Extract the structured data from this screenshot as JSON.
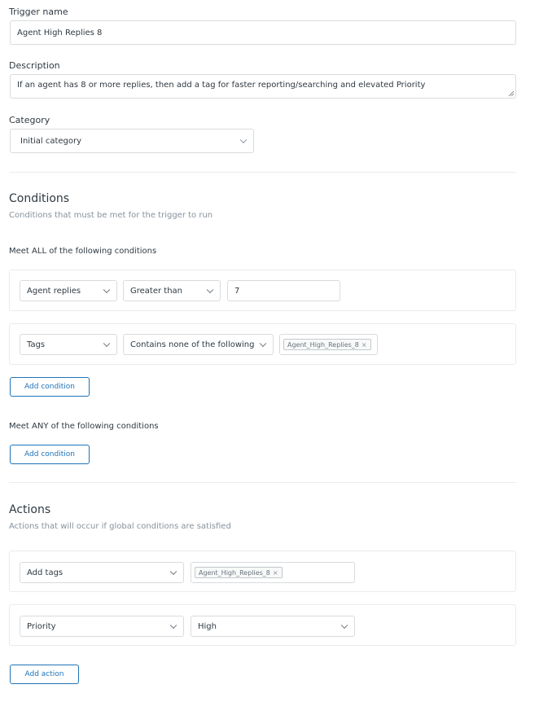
{
  "trigger_name": {
    "label": "Trigger name",
    "value": "Agent High Replies 8"
  },
  "description": {
    "label": "Description",
    "value": "If an agent has 8 or more replies, then add a tag for faster reporting/searching and elevated Priority"
  },
  "category": {
    "label": "Category",
    "value": "Initial category"
  },
  "conditions": {
    "title": "Conditions",
    "subtitle": "Conditions that must be met for the trigger to run",
    "all": {
      "title": "Meet ALL of the following conditions",
      "rows": [
        {
          "field": "Agent replies",
          "operator": "Greater than",
          "value": "7"
        },
        {
          "field": "Tags",
          "operator": "Contains none of the following",
          "tag": "Agent_High_Replies_8"
        }
      ],
      "add_label": "Add condition"
    },
    "any": {
      "title": "Meet ANY of the following conditions",
      "add_label": "Add condition"
    }
  },
  "actions": {
    "title": "Actions",
    "subtitle": "Actions that will occur if global conditions are satisfied",
    "rows": [
      {
        "field": "Add tags",
        "tag": "Agent_High_Replies_8"
      },
      {
        "field": "Priority",
        "value": "High"
      }
    ],
    "add_label": "Add action"
  },
  "icons": {
    "chevron": "chevron-down-icon",
    "remove": "close-icon",
    "resize": "resize-handle-icon"
  }
}
